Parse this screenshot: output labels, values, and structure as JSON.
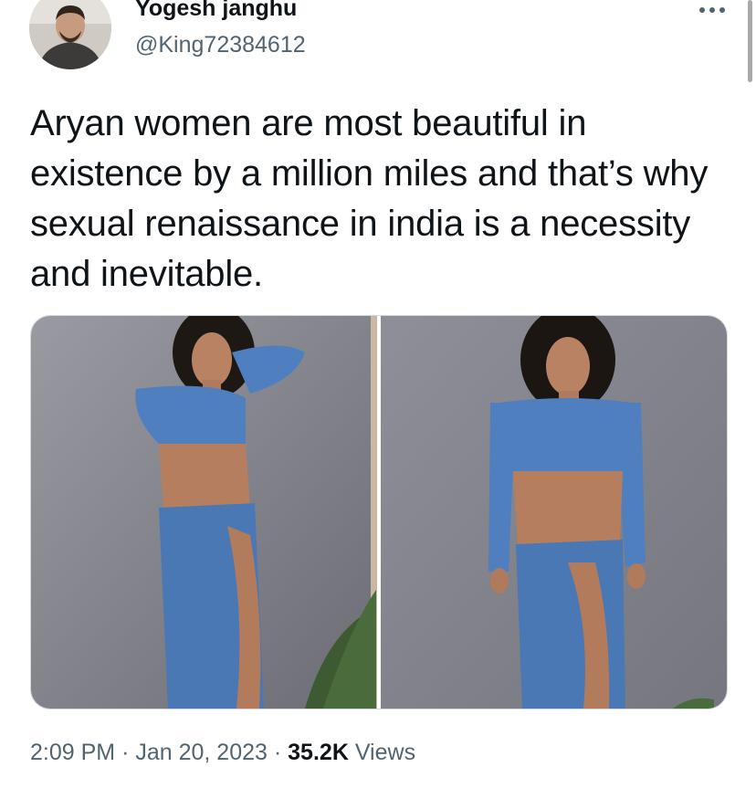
{
  "author": {
    "display_name": "Yogesh janghu",
    "handle": "@King72384612",
    "avatar_icon": "user-avatar-photo"
  },
  "more_icon": "more-dots-icon",
  "tweet": {
    "text": "Aryan women are most beautiful in existence by a million miles and that’s why sexual renaissance in india is a necessity and inevitable."
  },
  "media": {
    "count": 2,
    "photos": [
      {
        "description_icon": "photo-left"
      },
      {
        "description_icon": "photo-right"
      }
    ]
  },
  "meta": {
    "time": "2:09 PM",
    "separator": "·",
    "date": "Jan 20, 2023",
    "views_count": "35.2K",
    "views_label": "Views"
  },
  "colors": {
    "text_primary": "#0f1419",
    "text_secondary": "#536471",
    "border": "#cfd9de",
    "outfit_blue": "#4f7fbf"
  }
}
